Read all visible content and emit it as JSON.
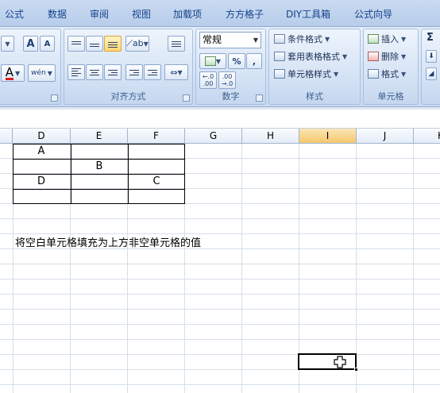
{
  "tabs": [
    "公式",
    "数据",
    "审阅",
    "视图",
    "加载项",
    "方方格子",
    "DIY工具箱",
    "公式向导"
  ],
  "font_group": {
    "grow_font": "A",
    "shrink_font": "A",
    "font_color": "A",
    "phonetic": "wén"
  },
  "alignment_group": {
    "label": "对齐方式"
  },
  "number_group": {
    "format_value": "常规",
    "percent": "%",
    "comma": ",",
    "inc_decimal": "←.0\n.00",
    "dec_decimal": ".00\n→.0",
    "label": "数字"
  },
  "styles_group": {
    "conditional_format": "条件格式",
    "format_as_table": "套用表格格式",
    "cell_styles": "单元格样式",
    "label": "样式"
  },
  "cells_group": {
    "insert": "插入",
    "delete": "删除",
    "format": "格式",
    "label": "单元格"
  },
  "editing_group": {
    "sum": "Σ"
  },
  "columns": [
    "D",
    "E",
    "F",
    "G",
    "H",
    "I",
    "J",
    "K"
  ],
  "selected_column": "I",
  "cells": {
    "D1": "A",
    "E2": "B",
    "D3": "D",
    "F3": "C"
  },
  "note": "将空白单元格填充为上方非空单元格的值",
  "colors": {
    "accent": "#15428b",
    "selected_header": "#f6c76c"
  }
}
